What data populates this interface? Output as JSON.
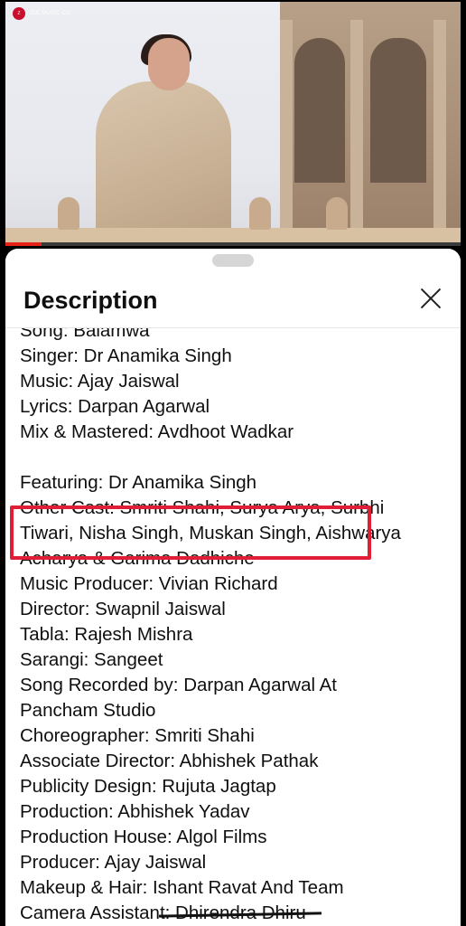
{
  "video": {
    "channel_logo_text": "ZEE MUSIC CO.",
    "progress_fraction": 0.08
  },
  "description_panel": {
    "title": "Description",
    "lines": [
      "Song: Balamwa",
      "Singer: Dr Anamika Singh",
      "Music: Ajay Jaiswal",
      "Lyrics: Darpan Agarwal",
      "Mix & Mastered: Avdhoot Wadkar",
      "",
      "Featuring: Dr Anamika Singh",
      "Other Cast: Smriti Shahi, Surya Arya, Surbhi",
      "Tiwari, Nisha Singh, Muskan Singh, Aishwarya",
      "Acharya & Garima Dadhiche",
      "Music Producer: Vivian Richard",
      "Director: Swapnil Jaiswal",
      "Tabla: Rajesh Mishra",
      "Sarangi: Sangeet",
      "Song Recorded by: Darpan Agarwal At",
      "Pancham Studio",
      "Choreographer: Smriti Shahi",
      "Associate Director: Abhishek Pathak",
      "Publicity Design: Rujuta Jagtap",
      "Production: Abhishek Yadav",
      "Production House: Algol Films",
      "Producer: Ajay Jaiswal",
      "Makeup & Hair: Ishant Ravat And Team",
      "Camera Assistant: Dhirendra Dhiru"
    ]
  },
  "colors": {
    "highlight_box": "#e01f36",
    "progress_fill": "#e62117",
    "sheet_background": "#ffffff"
  }
}
